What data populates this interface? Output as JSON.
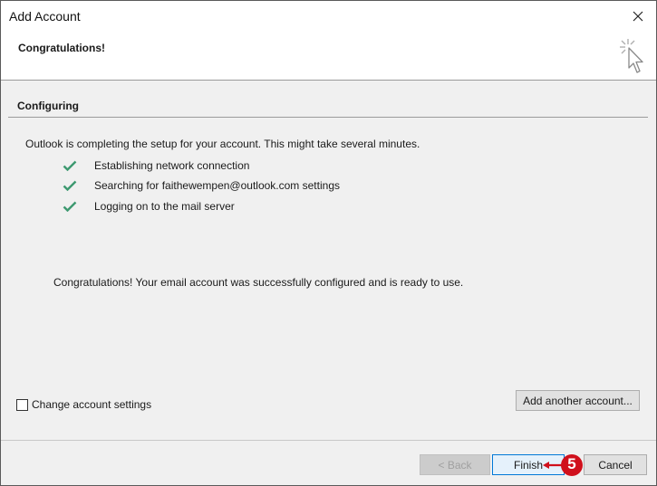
{
  "window": {
    "title": "Add Account",
    "close_icon": "close-icon"
  },
  "header": {
    "title": "Congratulations!",
    "icon": "wizard-cursor-icon"
  },
  "section": {
    "title": "Configuring",
    "intro": "Outlook is completing the setup for your account. This might take several minutes.",
    "steps": [
      {
        "label": "Establishing network connection",
        "status": "done"
      },
      {
        "label": "Searching for faithewempen@outlook.com settings",
        "status": "done"
      },
      {
        "label": "Logging on to the mail server",
        "status": "done"
      }
    ],
    "success_message": "Congratulations! Your email account was successfully configured and is ready to use."
  },
  "options": {
    "change_settings_label": "Change account settings",
    "change_settings_checked": false,
    "add_another_label": "Add another account..."
  },
  "footer": {
    "back_label": "< Back",
    "finish_label": "Finish",
    "cancel_label": "Cancel"
  },
  "callout": {
    "number": "5",
    "color": "#d0101c"
  },
  "colors": {
    "check": "#3d9970",
    "accent": "#0078d7"
  }
}
